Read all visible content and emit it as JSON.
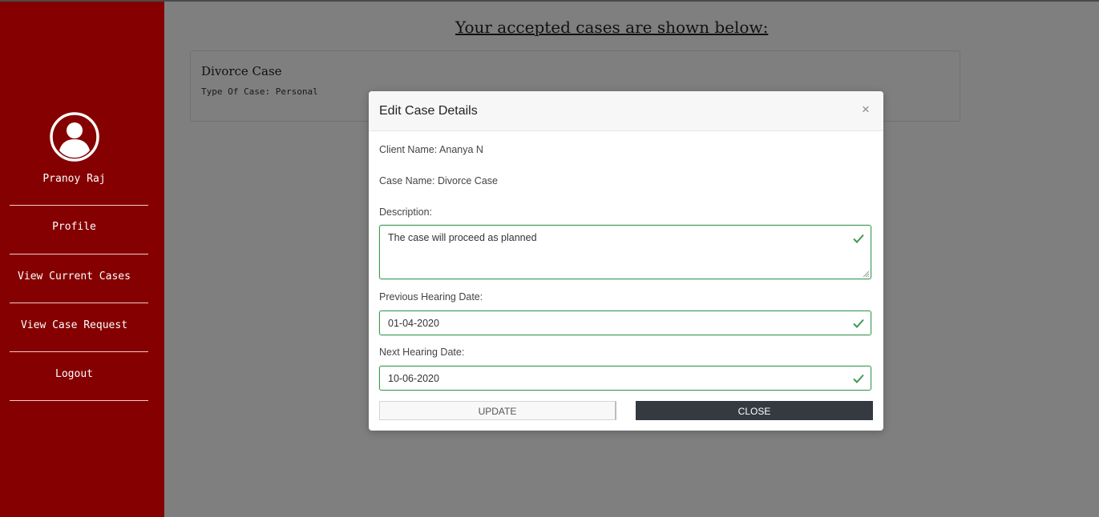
{
  "sidebar": {
    "user_name": "Pranoy Raj",
    "items": [
      {
        "label": "Profile"
      },
      {
        "label": "View Current Cases"
      },
      {
        "label": "View Case Request"
      },
      {
        "label": "Logout"
      }
    ]
  },
  "main": {
    "heading": "Your accepted cases are shown below:",
    "cases": [
      {
        "title": "Divorce Case",
        "type_line": "Type Of Case: Personal"
      }
    ]
  },
  "modal": {
    "title": "Edit Case Details",
    "close_icon": "×",
    "client_line": "Client Name: Ananya N",
    "case_line": "Case Name: Divorce Case",
    "description_label": "Description:",
    "description_value": "The case will proceed as planned",
    "prev_label": "Previous Hearing Date:",
    "prev_value": "01-04-2020",
    "next_label": "Next Hearing Date:",
    "next_value": "10-06-2020",
    "update_label": "UPDATE",
    "close_label": "CLOSE"
  },
  "colors": {
    "sidebar_bg": "#850000",
    "valid_green": "#3d9a54",
    "close_button_bg": "#343a40",
    "backdrop": "rgba(0,0,0,0.5)"
  }
}
